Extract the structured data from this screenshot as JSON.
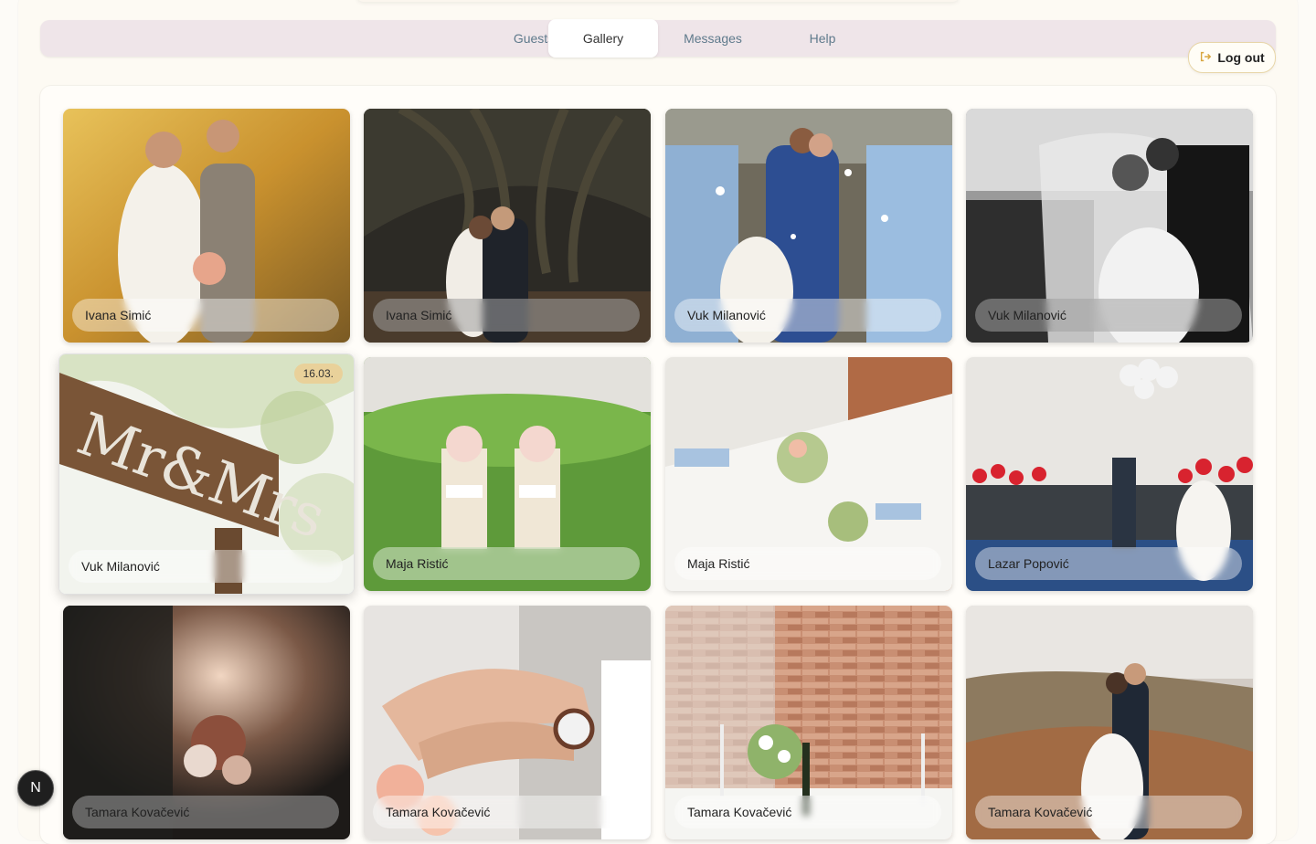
{
  "nav": {
    "tabs": [
      {
        "label": "Guests"
      },
      {
        "label": "Gallery",
        "active": true
      },
      {
        "label": "Messages"
      },
      {
        "label": "Help"
      }
    ],
    "logout_label": "Log out",
    "logout_icon": "logout-icon"
  },
  "gallery": {
    "items": [
      {
        "name": "Ivana Simić",
        "scene": "couple-autumn-park"
      },
      {
        "name": "Ivana Simić",
        "scene": "couple-palm-trees"
      },
      {
        "name": "Vuk Milanović",
        "scene": "couple-kiss-confetti"
      },
      {
        "name": "Vuk Milanović",
        "scene": "bw-veil-kiss"
      },
      {
        "name": "Vuk Milanović",
        "scene": "mr-mrs-sign",
        "date": "16.03."
      },
      {
        "name": "Maja Ristić",
        "scene": "chairs-on-lawn"
      },
      {
        "name": "Maja Ristić",
        "scene": "table-setting"
      },
      {
        "name": "Lazar Popović",
        "scene": "red-balloons-pool"
      },
      {
        "name": "Tamara Kovačević",
        "scene": "bouquet-dark"
      },
      {
        "name": "Tamara Kovačević",
        "scene": "hands-rings"
      },
      {
        "name": "Tamara Kovačević",
        "scene": "brick-wall-table"
      },
      {
        "name": "Tamara Kovačević",
        "scene": "couple-valley"
      }
    ]
  },
  "dev_badge": {
    "label": "N"
  }
}
